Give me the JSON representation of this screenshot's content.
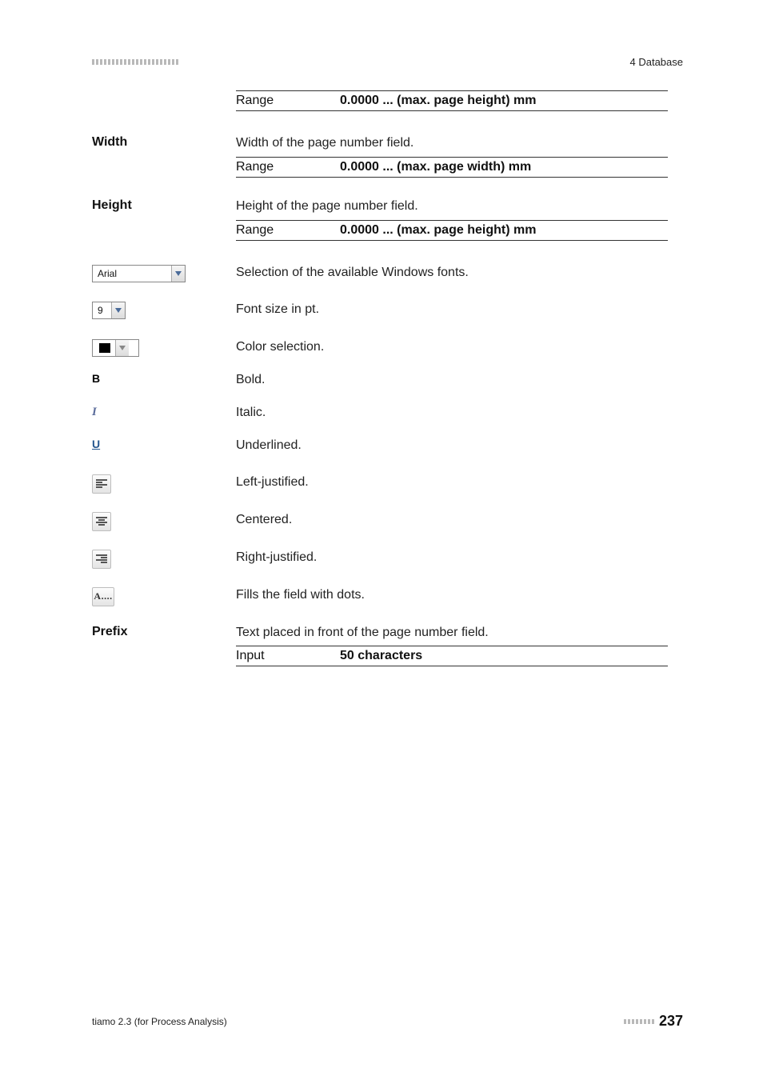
{
  "header": {
    "right": "4 Database"
  },
  "blocks": {
    "top_range": {
      "label": "Range",
      "value": "0.0000 ... (max. page height) mm"
    },
    "width": {
      "heading": "Width",
      "desc": "Width of the page number field.",
      "range_label": "Range",
      "range_value": "0.0000 ... (max. page width) mm"
    },
    "height": {
      "heading": "Height",
      "desc": "Height of the page number field.",
      "range_label": "Range",
      "range_value": "0.0000 ... (max. page height) mm"
    },
    "font_select": {
      "value": "Arial",
      "desc": "Selection of the available Windows fonts."
    },
    "font_size": {
      "value": "9",
      "desc": "Font size in pt."
    },
    "color": {
      "desc": "Color selection."
    },
    "bold": {
      "desc": "Bold."
    },
    "italic": {
      "desc": "Italic."
    },
    "underline": {
      "desc": "Underlined."
    },
    "align_left": {
      "desc": "Left-justified."
    },
    "align_center": {
      "desc": "Centered."
    },
    "align_right": {
      "desc": "Right-justified."
    },
    "dots": {
      "desc": "Fills the field with dots.",
      "glyph": "A...."
    },
    "prefix": {
      "heading": "Prefix",
      "desc": "Text placed in front of the page number field.",
      "input_label": "Input",
      "input_value": "50 characters"
    }
  },
  "footer": {
    "left": "tiamo 2.3 (for Process Analysis)",
    "page": "237"
  }
}
